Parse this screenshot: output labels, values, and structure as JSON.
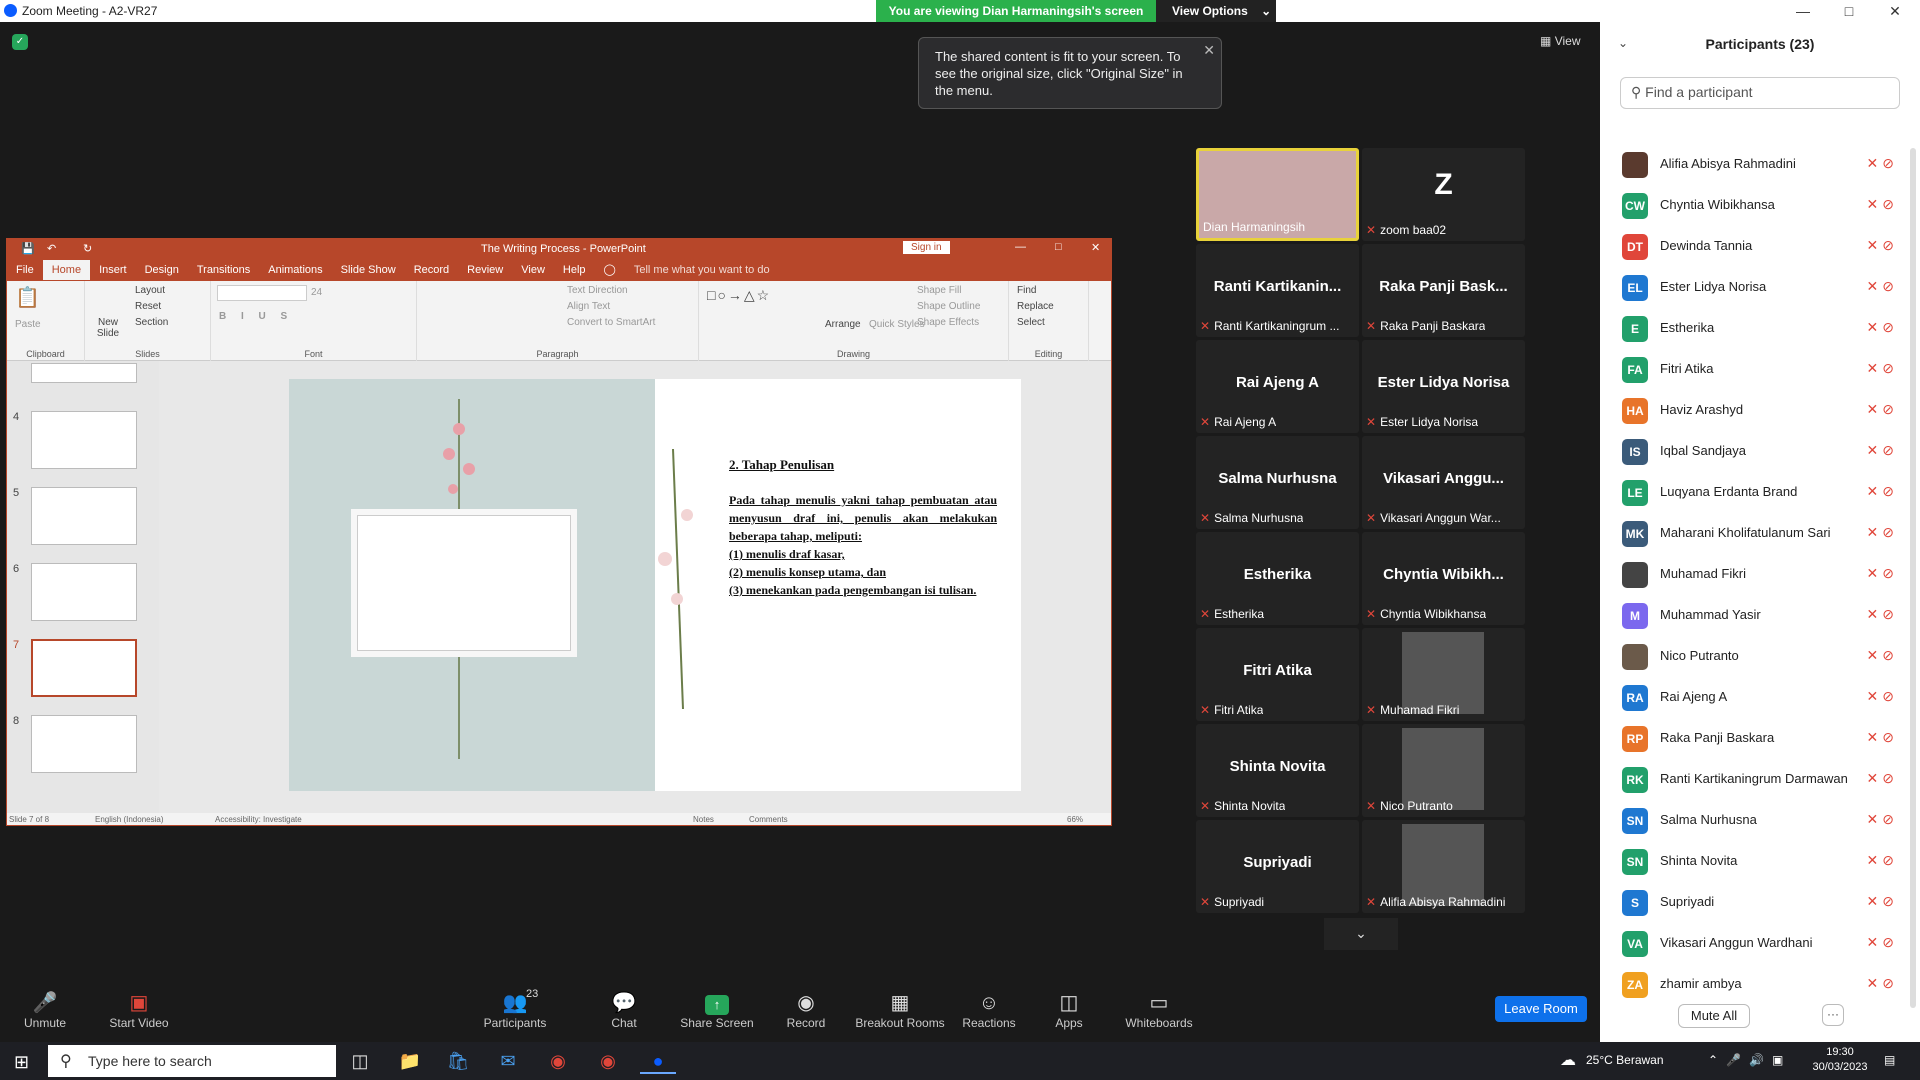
{
  "window": {
    "title": "Zoom Meeting - A2-VR27"
  },
  "banner": {
    "viewing": "You are viewing Dian Harmaningsih's screen",
    "view_options": "View Options"
  },
  "view_label": "View",
  "tooltip": {
    "text": "The shared content is fit to your screen. To see the original size, click \"Original Size\" in the menu."
  },
  "ppt": {
    "title": "The Writing Process - PowerPoint",
    "signin": "Sign in",
    "tabs": [
      "File",
      "Home",
      "Insert",
      "Design",
      "Transitions",
      "Animations",
      "Slide Show",
      "Record",
      "Review",
      "View",
      "Help"
    ],
    "tell_me": "Tell me what you want to do",
    "ribbon": {
      "paste": "Paste",
      "clipboard": "Clipboard",
      "new_slide": "New Slide",
      "layout": "Layout",
      "reset": "Reset",
      "section": "Section",
      "slides": "Slides",
      "font_size": "24",
      "font": "Font",
      "text_direction": "Text Direction",
      "align_text": "Align Text",
      "convert_smartart": "Convert to SmartArt",
      "paragraph": "Paragraph",
      "arrange": "Arrange",
      "quick_styles": "Quick Styles",
      "shape_fill": "Shape Fill",
      "shape_outline": "Shape Outline",
      "shape_effects": "Shape Effects",
      "drawing": "Drawing",
      "find": "Find",
      "replace": "Replace",
      "select": "Select",
      "editing": "Editing"
    },
    "thumb_numbers": [
      "4",
      "5",
      "6",
      "7",
      "8"
    ],
    "slide": {
      "heading": "2. Tahap Penulisan",
      "body": "Pada tahap menulis yakni tahap pembuatan atau menyusun draf ini, penulis akan melakukan beberapa tahap, meliputi:\n(1) menulis draf kasar,\n(2) menulis konsep utama, dan\n(3) menekankan pada pengembangan isi tulisan."
    },
    "status": {
      "slide_of": "Slide 7 of 8",
      "language": "English (Indonesia)",
      "accessibility": "Accessibility: Investigate",
      "notes": "Notes",
      "comments": "Comments",
      "zoom": "66%"
    }
  },
  "video_tiles": [
    {
      "big": "",
      "label": "Dian Harmaningsih",
      "speaker": true
    },
    {
      "big": "Z",
      "label": "zoom baa02"
    },
    {
      "big": "Ranti  Kartikanin...",
      "label": "Ranti Kartikaningrum ..."
    },
    {
      "big": "Raka Panji Bask...",
      "label": "Raka Panji Baskara"
    },
    {
      "big": "Rai Ajeng A",
      "label": "Rai Ajeng A"
    },
    {
      "big": "Ester Lidya Norisa",
      "label": "Ester Lidya Norisa"
    },
    {
      "big": "Salma Nurhusna",
      "label": "Salma Nurhusna"
    },
    {
      "big": "Vikasari  Anggu...",
      "label": "Vikasari Anggun War..."
    },
    {
      "big": "Estherika",
      "label": "Estherika"
    },
    {
      "big": "Chyntia  Wibikh...",
      "label": "Chyntia Wibikhansa"
    },
    {
      "big": "Fitri Atika",
      "label": "Fitri Atika"
    },
    {
      "big": "",
      "label": "Muhamad Fikri"
    },
    {
      "big": "Shinta Novita",
      "label": "Shinta Novita"
    },
    {
      "big": "",
      "label": "Nico Putranto"
    },
    {
      "big": "Supriyadi",
      "label": "Supriyadi"
    },
    {
      "big": "",
      "label": "Alifia Abisya Rahmadini"
    }
  ],
  "participants": {
    "title": "Participants (23)",
    "search_placeholder": "Find a participant",
    "mute_all": "Mute All",
    "more": "···",
    "list": [
      {
        "initials": "",
        "name": "Alifia Abisya Rahmadini",
        "color": "#5a3a2e"
      },
      {
        "initials": "CW",
        "name": "Chyntia Wibikhansa",
        "color": "#22a06b"
      },
      {
        "initials": "DT",
        "name": "Dewinda Tannia",
        "color": "#e0463a"
      },
      {
        "initials": "EL",
        "name": "Ester Lidya Norisa",
        "color": "#1f78d1"
      },
      {
        "initials": "E",
        "name": "Estherika",
        "color": "#22a06b"
      },
      {
        "initials": "FA",
        "name": "Fitri Atika",
        "color": "#22a06b"
      },
      {
        "initials": "HA",
        "name": "Haviz Arashyd",
        "color": "#e8742a"
      },
      {
        "initials": "IS",
        "name": "Iqbal Sandjaya",
        "color": "#3b5b7a"
      },
      {
        "initials": "LE",
        "name": "Luqyana Erdanta Brand",
        "color": "#22a06b"
      },
      {
        "initials": "MK",
        "name": "Maharani Kholifatulanum Sari",
        "color": "#3b5b7a"
      },
      {
        "initials": "",
        "name": "Muhamad Fikri",
        "color": "#444444"
      },
      {
        "initials": "M",
        "name": "Muhammad Yasir",
        "color": "#7b68ee"
      },
      {
        "initials": "",
        "name": "Nico Putranto",
        "color": "#6b5a4a"
      },
      {
        "initials": "RA",
        "name": "Rai Ajeng A",
        "color": "#1f78d1"
      },
      {
        "initials": "RP",
        "name": "Raka Panji Baskara",
        "color": "#e8742a"
      },
      {
        "initials": "RK",
        "name": "Ranti Kartikaningrum Darmawan",
        "color": "#22a06b"
      },
      {
        "initials": "SN",
        "name": "Salma Nurhusna",
        "color": "#1f78d1"
      },
      {
        "initials": "SN",
        "name": "Shinta Novita",
        "color": "#22a06b"
      },
      {
        "initials": "S",
        "name": "Supriyadi",
        "color": "#1f78d1"
      },
      {
        "initials": "VA",
        "name": "Vikasari Anggun Wardhani",
        "color": "#22a06b"
      },
      {
        "initials": "ZA",
        "name": "zhamir ambya",
        "color": "#f0a020"
      }
    ]
  },
  "toolbar": {
    "unmute": "Unmute",
    "start_video": "Start Video",
    "participants": "Participants",
    "participants_count": "23",
    "chat": "Chat",
    "share_screen": "Share Screen",
    "record": "Record",
    "breakout": "Breakout Rooms",
    "reactions": "Reactions",
    "apps": "Apps",
    "whiteboards": "Whiteboards",
    "leave": "Leave Room"
  },
  "taskbar": {
    "search_placeholder": "Type here to search",
    "weather": "25°C  Berawan",
    "time": "19:30",
    "date": "30/03/2023"
  }
}
